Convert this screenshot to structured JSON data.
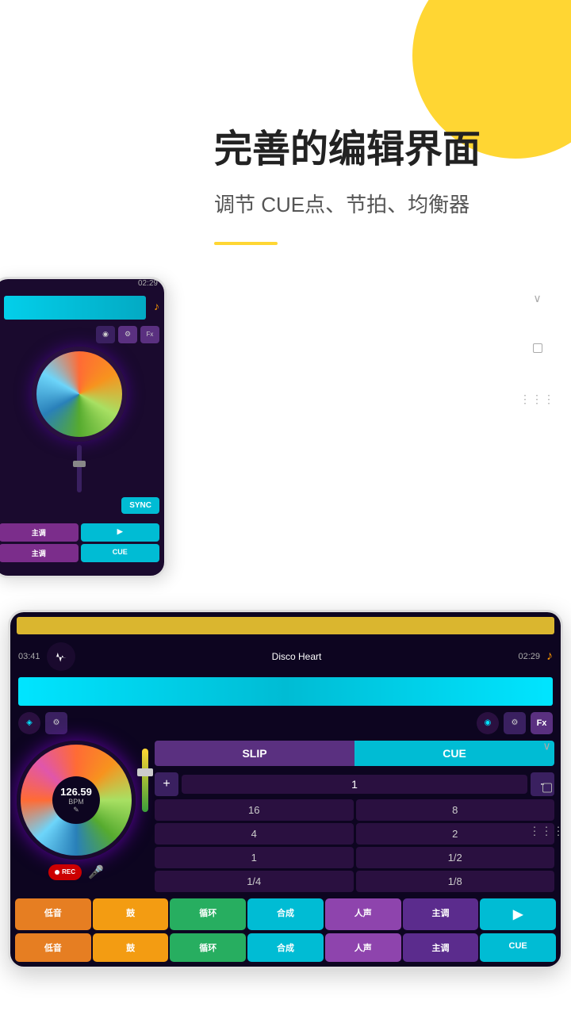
{
  "page": {
    "background_color": "#ffffff",
    "blob_color": "#FFD633"
  },
  "text_section": {
    "main_title": "完善的编辑界面",
    "sub_title": "调节 CUE点、节拍、均衡器",
    "yellow_line": true
  },
  "screen1": {
    "time": "02:29",
    "music_note": "♪",
    "sync_label": "SYNC",
    "buttons": [
      {
        "label": "主调",
        "type": "purple"
      },
      {
        "label": "▶",
        "type": "cyan"
      },
      {
        "label": "主调",
        "type": "purple"
      },
      {
        "label": "CUE",
        "type": "cyan"
      }
    ]
  },
  "screen2": {
    "time_left": "03:41",
    "song_name": "Disco Heart",
    "time_right": "02:29",
    "heartbeat_icon": "♡",
    "music_note": "♪",
    "bpm": "126.59",
    "bpm_label": "BPM",
    "slip_label": "SLIP",
    "cue_header_label": "CUE",
    "beat_plus": "+",
    "beat_value": "1",
    "beat_minus": "-",
    "beat_grid": [
      "16",
      "8",
      "4",
      "2",
      "1",
      "1/2",
      "1/4",
      "1/8"
    ],
    "rec_label": "REC",
    "pads_row1": [
      "低音",
      "鼓",
      "循环",
      "合成",
      "人声",
      "主调",
      "▶",
      ""
    ],
    "pads_row2": [
      "低音",
      "鼓",
      "循环",
      "合成",
      "人声",
      "主调",
      "",
      "CUE"
    ],
    "controls": {
      "circle_icon": "◉",
      "sliders_icon": "⚙",
      "fx_label": "Fx",
      "dropdown": "∨"
    }
  },
  "icons": {
    "dropdown_arrow": "∨",
    "resize_handle": "⋮",
    "dots_v": "⋮⋮⋮"
  }
}
